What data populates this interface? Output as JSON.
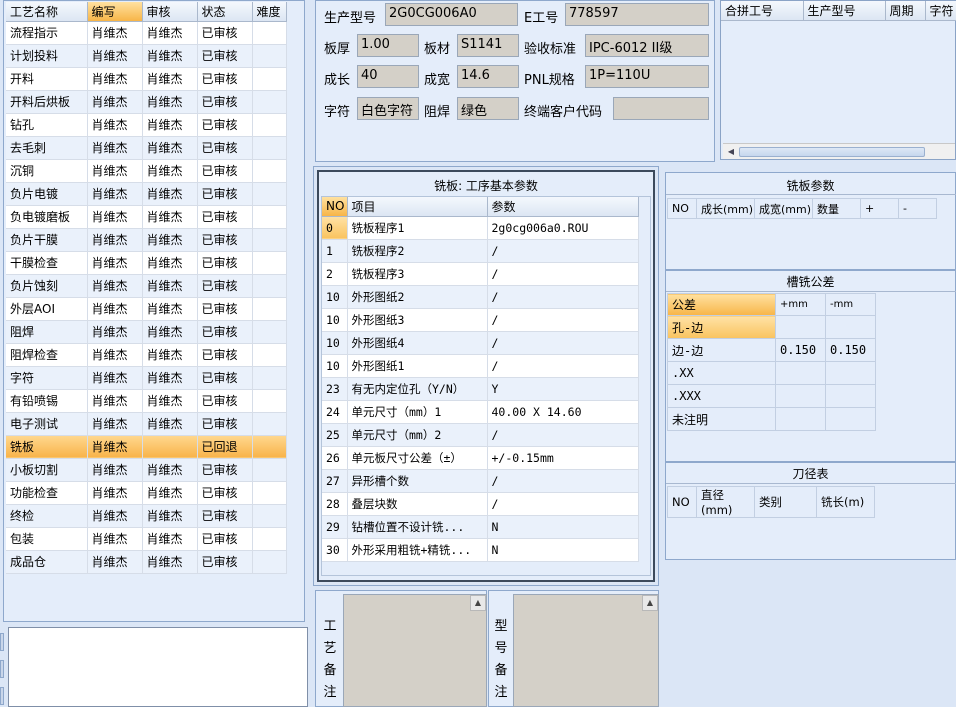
{
  "process_grid": {
    "headers": [
      "工艺名称",
      "编写",
      "审核",
      "状态",
      "难度"
    ],
    "rows": [
      {
        "name": "流程指示",
        "writer": "肖维杰",
        "reviewer": "肖维杰",
        "status": "已审核",
        "difficulty": ""
      },
      {
        "name": "计划投料",
        "writer": "肖维杰",
        "reviewer": "肖维杰",
        "status": "已审核",
        "difficulty": ""
      },
      {
        "name": "开料",
        "writer": "肖维杰",
        "reviewer": "肖维杰",
        "status": "已审核",
        "difficulty": ""
      },
      {
        "name": "开料后烘板",
        "writer": "肖维杰",
        "reviewer": "肖维杰",
        "status": "已审核",
        "difficulty": ""
      },
      {
        "name": "钻孔",
        "writer": "肖维杰",
        "reviewer": "肖维杰",
        "status": "已审核",
        "difficulty": ""
      },
      {
        "name": "去毛刺",
        "writer": "肖维杰",
        "reviewer": "肖维杰",
        "status": "已审核",
        "difficulty": ""
      },
      {
        "name": "沉铜",
        "writer": "肖维杰",
        "reviewer": "肖维杰",
        "status": "已审核",
        "difficulty": ""
      },
      {
        "name": "负片电镀",
        "writer": "肖维杰",
        "reviewer": "肖维杰",
        "status": "已审核",
        "difficulty": ""
      },
      {
        "name": "负电镀磨板",
        "writer": "肖维杰",
        "reviewer": "肖维杰",
        "status": "已审核",
        "difficulty": ""
      },
      {
        "name": "负片干膜",
        "writer": "肖维杰",
        "reviewer": "肖维杰",
        "status": "已审核",
        "difficulty": ""
      },
      {
        "name": "干膜检查",
        "writer": "肖维杰",
        "reviewer": "肖维杰",
        "status": "已审核",
        "difficulty": ""
      },
      {
        "name": "负片蚀刻",
        "writer": "肖维杰",
        "reviewer": "肖维杰",
        "status": "已审核",
        "difficulty": ""
      },
      {
        "name": "外层AOI",
        "writer": "肖维杰",
        "reviewer": "肖维杰",
        "status": "已审核",
        "difficulty": ""
      },
      {
        "name": "阻焊",
        "writer": "肖维杰",
        "reviewer": "肖维杰",
        "status": "已审核",
        "difficulty": ""
      },
      {
        "name": "阻焊检查",
        "writer": "肖维杰",
        "reviewer": "肖维杰",
        "status": "已审核",
        "difficulty": ""
      },
      {
        "name": "字符",
        "writer": "肖维杰",
        "reviewer": "肖维杰",
        "status": "已审核",
        "difficulty": ""
      },
      {
        "name": "有铅喷锡",
        "writer": "肖维杰",
        "reviewer": "肖维杰",
        "status": "已审核",
        "difficulty": ""
      },
      {
        "name": "电子测试",
        "writer": "肖维杰",
        "reviewer": "肖维杰",
        "status": "已审核",
        "difficulty": ""
      },
      {
        "name": "铣板",
        "writer": "肖维杰",
        "reviewer": "",
        "status": "已回退",
        "difficulty": "",
        "selected": true
      },
      {
        "name": "小板切割",
        "writer": "肖维杰",
        "reviewer": "肖维杰",
        "status": "已审核",
        "difficulty": ""
      },
      {
        "name": "功能检查",
        "writer": "肖维杰",
        "reviewer": "肖维杰",
        "status": "已审核",
        "difficulty": ""
      },
      {
        "name": "终检",
        "writer": "肖维杰",
        "reviewer": "肖维杰",
        "status": "已审核",
        "difficulty": ""
      },
      {
        "name": "包装",
        "writer": "肖维杰",
        "reviewer": "肖维杰",
        "status": "已审核",
        "difficulty": ""
      },
      {
        "name": "成品仓",
        "writer": "肖维杰",
        "reviewer": "肖维杰",
        "status": "已审核",
        "difficulty": ""
      }
    ]
  },
  "info": {
    "model_label": "生产型号",
    "model_value": "2G0CG006A0",
    "e_label": "E工号",
    "e_value": "778597",
    "thickness_label": "板厚",
    "thickness_value": "1.00",
    "material_label": "板材",
    "material_value": "S1141",
    "standard_label": "验收标准",
    "standard_value": "IPC-6012 II级",
    "length_label": "成长",
    "length_value": "40",
    "width_label": "成宽",
    "width_value": "14.6",
    "pnl_label": "PNL规格",
    "pnl_value": "1P=110U",
    "char_label": "字符",
    "char_value": "白色字符",
    "mask_label": "阻焊",
    "mask_value": "绿色",
    "customer_label": "终端客户代码",
    "customer_value": ""
  },
  "combine_grid": {
    "headers": [
      "合拼工号",
      "生产型号",
      "周期",
      "字符"
    ]
  },
  "params": {
    "title": "铣板: 工序基本参数",
    "headers": [
      "NO",
      "项目",
      "参数"
    ],
    "rows": [
      {
        "no": "0",
        "item": "铣板程序1",
        "value": "2g0cg006a0.ROU"
      },
      {
        "no": "1",
        "item": "铣板程序2",
        "value": "/"
      },
      {
        "no": "2",
        "item": "铣板程序3",
        "value": "/"
      },
      {
        "no": "10",
        "item": "外形图纸2",
        "value": "/"
      },
      {
        "no": "10",
        "item": "外形图纸3",
        "value": "/"
      },
      {
        "no": "10",
        "item": "外形图纸4",
        "value": "/"
      },
      {
        "no": "10",
        "item": "外形图纸1",
        "value": "/"
      },
      {
        "no": "23",
        "item": "有无内定位孔（Y/N）",
        "value": "Y"
      },
      {
        "no": "24",
        "item": "单元尺寸（mm）1",
        "value": "40.00 X 14.60"
      },
      {
        "no": "25",
        "item": "单元尺寸（mm）2",
        "value": "/"
      },
      {
        "no": "26",
        "item": "单元板尺寸公差（±）",
        "value": "+/-0.15mm"
      },
      {
        "no": "27",
        "item": "异形槽个数",
        "value": "/"
      },
      {
        "no": "28",
        "item": "叠层块数",
        "value": "/"
      },
      {
        "no": "29",
        "item": "钻槽位置不设计铣...",
        "value": "N"
      },
      {
        "no": "30",
        "item": "外形采用粗铣+精铣...",
        "value": "N"
      }
    ]
  },
  "mill_params": {
    "title": "铣板参数",
    "headers": [
      "NO",
      "成长(mm)",
      "成宽(mm)",
      "数量",
      "+",
      "-"
    ]
  },
  "slot_tol": {
    "title": "槽铣公差",
    "headers": [
      "公差",
      "+mm",
      "-mm"
    ],
    "rows": [
      {
        "label": "孔-边",
        "plus": "",
        "minus": ""
      },
      {
        "label": "边-边",
        "plus": "0.150",
        "minus": "0.150"
      },
      {
        "label": ".XX",
        "plus": "",
        "minus": ""
      },
      {
        "label": ".XXX",
        "plus": "",
        "minus": ""
      },
      {
        "label": "未注明",
        "plus": "",
        "minus": ""
      }
    ]
  },
  "tool_table": {
    "title": "刀径表",
    "headers": [
      "NO",
      "直径(mm)",
      "类别",
      "铣长(m)"
    ]
  },
  "notes": {
    "process_label": [
      "工",
      "艺",
      "备",
      "注"
    ],
    "model_label": [
      "型",
      "号",
      "备",
      "注"
    ]
  }
}
